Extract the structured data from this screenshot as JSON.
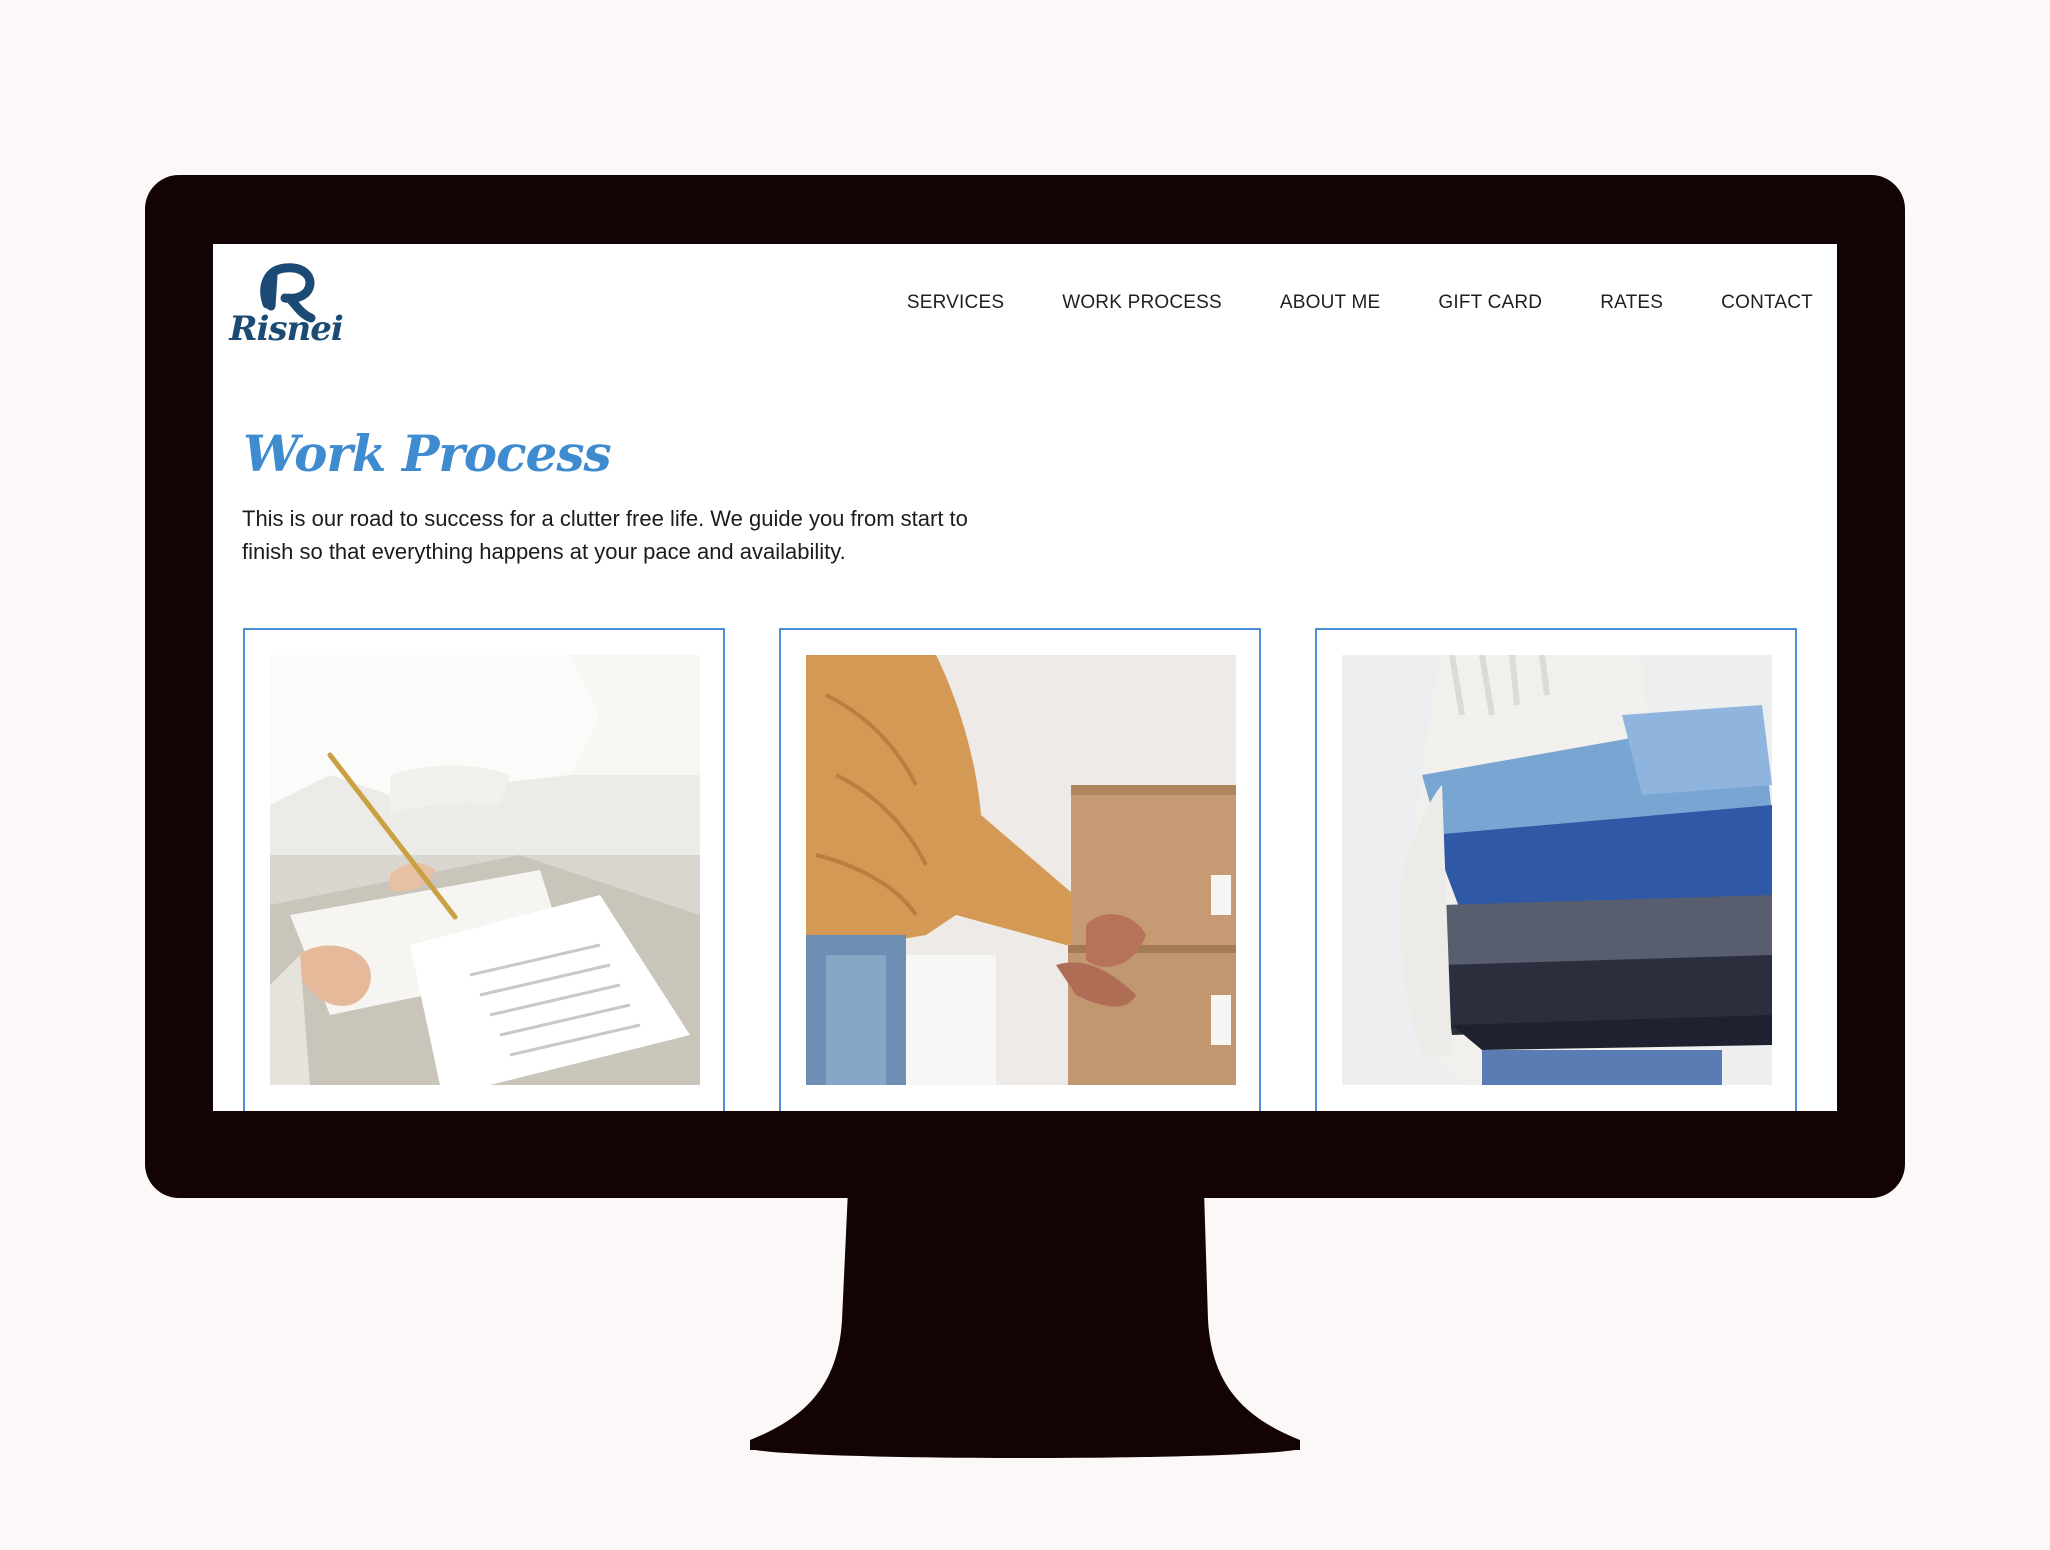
{
  "logo": {
    "monogram": "R",
    "wordmark": "Risnei"
  },
  "nav": {
    "items": [
      {
        "label": "SERVICES"
      },
      {
        "label": "WORK PROCESS"
      },
      {
        "label": "ABOUT ME"
      },
      {
        "label": "GIFT CARD"
      },
      {
        "label": "RATES"
      },
      {
        "label": "CONTACT"
      }
    ]
  },
  "main": {
    "title": "Work Process",
    "intro_line1": "This is our road to success for a clutter free life. We guide you from start to",
    "intro_line2": "finish so that everything happens at your pace and availability."
  },
  "colors": {
    "accent": "#3f8bd0",
    "card_border": "#4a90d9",
    "logo": "#1b4b74",
    "bezel": "#140304",
    "backdrop": "#fcf8f7"
  }
}
